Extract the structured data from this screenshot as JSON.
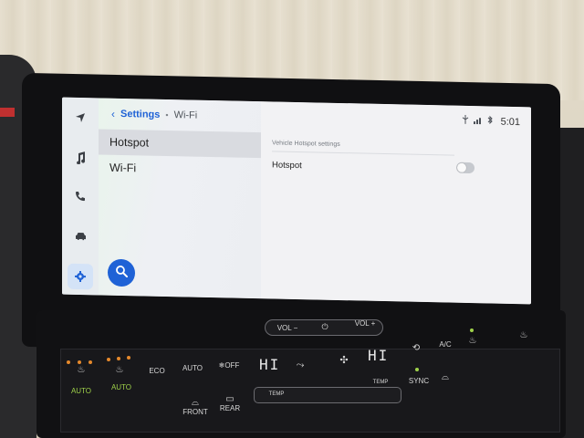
{
  "breadcrumb": {
    "parent": "Settings",
    "separator": "•",
    "current": "Wi-Fi"
  },
  "list": {
    "items": [
      {
        "label": "Hotspot",
        "selected": true
      },
      {
        "label": "Wi-Fi",
        "selected": false
      }
    ]
  },
  "rail": {
    "icons": [
      "navigation-icon",
      "music-icon",
      "phone-icon",
      "car-icon",
      "settings-icon"
    ],
    "active": "settings-icon"
  },
  "status": {
    "time": "5:01",
    "icons": [
      "usb-icon",
      "signal-icon",
      "bluetooth-icon"
    ]
  },
  "detail": {
    "section_title": "Vehicle Hotspot settings",
    "hotspot_label": "Hotspot",
    "hotspot_enabled": false
  },
  "colors": {
    "accent": "#1f62d6",
    "indicator_green": "#9fd24a",
    "indicator_amber": "#e5892c"
  },
  "console": {
    "vol_down": "VOL −",
    "vol_up": "VOL +",
    "eco": "ECO",
    "auto": "AUTO",
    "off": "❄OFF",
    "left_temp": "HI",
    "right_temp": "HI",
    "temp_left": "TEMP",
    "temp_right": "TEMP",
    "ac": "A/C",
    "sync": "SYNC",
    "front": "FRONT",
    "rear": "REAR",
    "seat_left_auto": "AUTO",
    "seat_right_auto": "AUTO"
  }
}
